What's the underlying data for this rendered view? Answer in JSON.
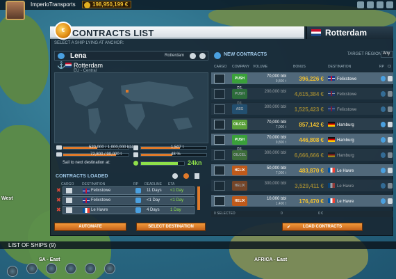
{
  "topbar": {
    "company": "ImperioTransports",
    "money": "198,950,199 €",
    "icons": [
      "trophy-icon",
      "gear-icon",
      "calendar-icon",
      "close-icon"
    ]
  },
  "window": {
    "title": "CONTRACTS LIST",
    "port": "Rotterdam",
    "hint": "SELECT A SHIP LYING AT ANCHOR:"
  },
  "ship": {
    "name": "Lena",
    "location": "Rotterdam",
    "anchor_port": "Rotterdam",
    "region": "EU - Central"
  },
  "stats": {
    "cargo1": "520,000 / 1,000,000 bbl",
    "cargo1_fill": 0.52,
    "cargo2": "72,800 / 90,000 t",
    "cargo2_fill": 0.81,
    "sail_label": "Sail to next destination at:",
    "fuel": "1,507 t",
    "fuel_fill": 0.6,
    "condition": "48 %",
    "condition_fill": 0.48,
    "speed_fill": 0.85,
    "speed": "24kn"
  },
  "contracts_loaded": {
    "title": "CONTRACTS LOADED",
    "columns": {
      "cargo": "CARGO",
      "destination": "DESTINATION",
      "rp": "RP",
      "deadline": "DEADLINE",
      "eta": "ETA"
    },
    "rows": [
      {
        "destination": "Felixstowe",
        "deadline": "11 Days",
        "eta": "<1 Day",
        "flag": "uk"
      },
      {
        "destination": "Felixstowe",
        "deadline": "<1 Day",
        "eta": "<1 Day",
        "flag": "uk"
      },
      {
        "destination": "Le Havre",
        "deadline": "4 Days",
        "eta": "1 Day",
        "flag": "fr"
      }
    ]
  },
  "buttons": {
    "automate": "AUTOMATE",
    "select_destination": "SELECT DESTINATION",
    "load_contracts": "LOAD CONTRACTS"
  },
  "new_contracts": {
    "title": "NEW CONTRACTS",
    "target_region_label": "TARGET REGION",
    "target_region_value": "Any",
    "columns": {
      "cargo": "CARGO",
      "company": "COMPANY",
      "volume": "VOLUME",
      "bonus": "BONUS",
      "destination": "DESTINATION",
      "rp": "RP",
      "info": "CI"
    },
    "rows": [
      {
        "company": "PUSH OIL",
        "vol": "70,000 bbl",
        "vol2": "9,800 t",
        "bonus": "396,226 €",
        "dest": "Felixstowe",
        "flag": "uk",
        "state": "sel",
        "color": "#3aa03a"
      },
      {
        "company": "PUSH OIL",
        "vol": "200,000 bbl",
        "vol2": "",
        "bonus": "4,615,384 €",
        "dest": "Felixstowe",
        "flag": "uk",
        "state": "dim",
        "color": "#3aa03a"
      },
      {
        "company": "AEG",
        "vol": "300,000 bbl",
        "vol2": "",
        "bonus": "1,525,423 €",
        "dest": "Felixstowe",
        "flag": "uk",
        "state": "dim",
        "color": "#2a6a9a"
      },
      {
        "company": "OILCEL",
        "vol": "70,000 bbl",
        "vol2": "7,000 t",
        "bonus": "857,142 €",
        "dest": "Hamburg",
        "flag": "de",
        "state": "",
        "color": "#5aa03a"
      },
      {
        "company": "PUSH OIL",
        "vol": "70,000 bbl",
        "vol2": "9,800 t",
        "bonus": "446,808 €",
        "dest": "Hamburg",
        "flag": "de",
        "state": "sel",
        "color": "#3aa03a"
      },
      {
        "company": "OILCEL",
        "vol": "300,000 bbl",
        "vol2": "",
        "bonus": "6,666,666 €",
        "dest": "Hamburg",
        "flag": "de",
        "state": "dim",
        "color": "#5aa03a"
      },
      {
        "company": "HELIX",
        "vol": "50,000 bbl",
        "vol2": "7,000 t",
        "bonus": "483,870 €",
        "dest": "Le Havre",
        "flag": "fr",
        "state": "sel",
        "color": "#c05a1a"
      },
      {
        "company": "HELIX",
        "vol": "300,000 bbl",
        "vol2": "",
        "bonus": "3,529,411 €",
        "dest": "Le Havre",
        "flag": "fr",
        "state": "dim",
        "color": "#c05a1a"
      },
      {
        "company": "HELIX",
        "vol": "10,000 bbl",
        "vol2": "1,400 t",
        "bonus": "176,470 €",
        "dest": "Le Havre",
        "flag": "fr",
        "state": "sel",
        "color": "#c05a1a"
      }
    ],
    "footer_selected": "0 SELECTED",
    "footer_sum1": "0",
    "footer_sum2": "0 €"
  },
  "bottom": {
    "list_of_ships": "LIST OF SHIPS (9)",
    "label_sa": "SA - East",
    "label_africa": "AFRICA - East",
    "label_west": "West"
  },
  "colors": {
    "accent": "#e07a2a",
    "gold": "#f2c230",
    "panel": "#192834",
    "header_blue": "#9fc8e8"
  }
}
